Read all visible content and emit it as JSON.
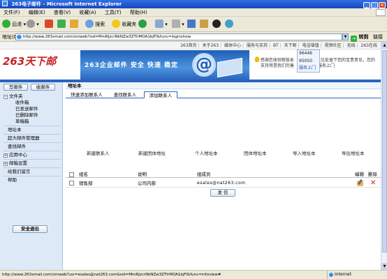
{
  "window": {
    "title": "263电子邮件 - Microsoft Internet Explorer"
  },
  "menu": [
    "文件(F)",
    "编辑(E)",
    "查看(V)",
    "收藏(A)",
    "工具(T)",
    "帮助(H)"
  ],
  "toolbar": {
    "back": "后退",
    "search": "搜索",
    "favorites": "收藏夹"
  },
  "address": {
    "label": "地址(D)",
    "url": "http://www.263xmail.com/xmweb?sid=MmRJzcrNkNZw3ZTlrMOA1bjFl&func=loginshow",
    "go": "转到",
    "links": "链接"
  },
  "topnav": [
    "263首页",
    "关于263",
    "媒体中心",
    "服务与支持",
    "BT",
    "天下邮",
    "电话增值",
    "视频社区",
    "无线",
    "263在线"
  ],
  "logo": {
    "text": "263天下邮"
  },
  "banner": {
    "slogan": "263企业邮件  安全 快速 稳定",
    "at": "@"
  },
  "notice": {
    "line1": "感谢您体验新版本",
    "line1b": "比处留下您的宝贵意见，您的",
    "line2": "支持将是我们完善",
    "line2b": "服务上门"
  },
  "popup": {
    "items": [
      "96446",
      "95050",
      "服务上门"
    ]
  },
  "sidebar": {
    "write": "写邮件",
    "receive": "收邮件",
    "folders_label": "文件夹",
    "folders": [
      "收件箱",
      "已发送邮件",
      "已删除邮件",
      "草稿箱"
    ],
    "items": [
      "地址本",
      "超大邮件管理器",
      "查找邮件"
    ],
    "app_center": "应用中心",
    "mail_settings": "邮箱设置",
    "bottom_items": [
      "给我们留言",
      "帮助"
    ],
    "logout": "安全退出"
  },
  "main": {
    "breadcrumb": "地址本",
    "tabs": [
      "快速添加联系人",
      "查找联系人",
      "添加联系人"
    ],
    "actions": [
      "新建联系人",
      "新建团体地址",
      "个人地址本",
      "团体地址本",
      "导入地址本",
      "导出地址本"
    ],
    "table": {
      "headers": {
        "group": "组名",
        "desc": "说明",
        "member": "组成员",
        "edit": "编辑",
        "delete": "删除"
      },
      "rows": [
        {
          "group": "销售部",
          "desc": "公司内部",
          "member": "esales@nat263.com"
        }
      ]
    },
    "send": "发 信"
  },
  "status": {
    "text": "http://www.263xmail.com/xmweb?usr=esales@nat263.com&sid=MmRJzcrNkNZw3ZTlrMOA1bjFl&func=infoview#",
    "zone": "Internet"
  }
}
